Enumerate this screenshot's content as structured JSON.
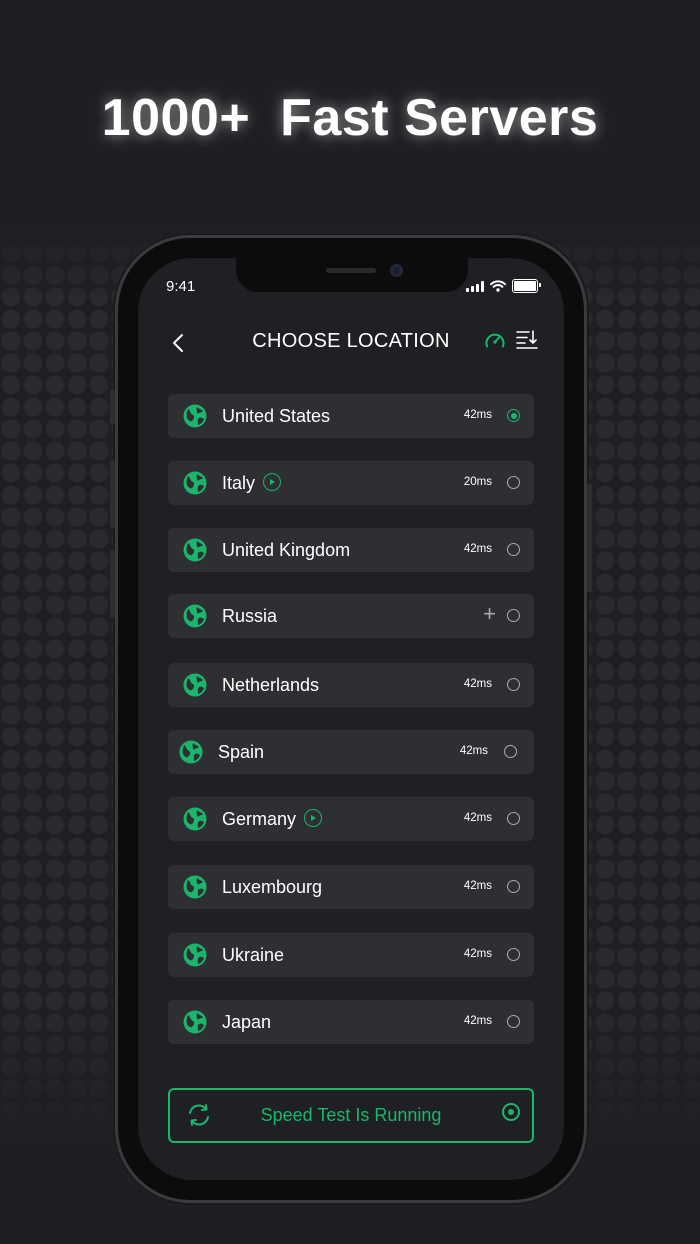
{
  "headline": "1000+  Fast Servers",
  "status_bar": {
    "time": "9:41"
  },
  "nav": {
    "title": "CHOOSE LOCATION",
    "back_icon": "chevron-left-icon",
    "speed_icon": "speedometer-icon",
    "sort_icon": "sort-icon"
  },
  "accent_color": "#1bb56b",
  "locations": [
    {
      "name": "United States",
      "ping": "42ms",
      "selected": true,
      "badge": "none"
    },
    {
      "name": "Italy",
      "ping": "20ms",
      "selected": false,
      "badge": "play"
    },
    {
      "name": "United Kingdom",
      "ping": "42ms",
      "selected": false,
      "badge": "none"
    },
    {
      "name": "Russia",
      "ping": "",
      "selected": false,
      "badge": "plus"
    },
    {
      "name": "Netherlands",
      "ping": "42ms",
      "selected": false,
      "badge": "none"
    },
    {
      "name": "Spain",
      "ping": "42ms",
      "selected": false,
      "badge": "none"
    },
    {
      "name": "Germany",
      "ping": "42ms",
      "selected": false,
      "badge": "play"
    },
    {
      "name": "Luxembourg",
      "ping": "42ms",
      "selected": false,
      "badge": "none"
    },
    {
      "name": "Ukraine",
      "ping": "42ms",
      "selected": false,
      "badge": "none"
    },
    {
      "name": "Japan",
      "ping": "42ms",
      "selected": false,
      "badge": "none"
    }
  ],
  "speed_test": {
    "label": "Speed Test Is Running"
  }
}
